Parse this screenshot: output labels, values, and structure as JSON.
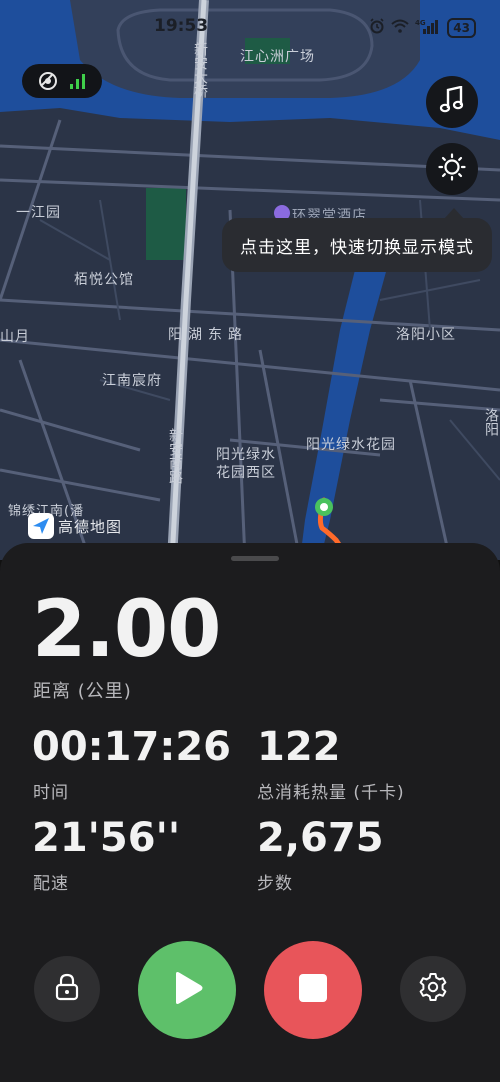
{
  "status_bar": {
    "time": "19:53",
    "battery": "43",
    "network": "4G",
    "icons": [
      "alarm-icon",
      "wifi-icon",
      "signal-icon",
      "battery-icon"
    ]
  },
  "map": {
    "labels": {
      "jiangxinzhou": "江心洲广场",
      "xinan_bridge": "新安大桥",
      "yijiangyuan": "一江园",
      "boyue": "栢悦公馆",
      "hotel": "环翠堂酒店",
      "yanghu_road": "阳湖东路",
      "shanyue": "山月",
      "luoyang": "洛阳小区",
      "jiangnan": "江南宸府",
      "xinan_south": "新安南路",
      "yangguang_west": "阳光绿水花园西区",
      "yangguang": "阳光绿水花园",
      "jinxiu": "锦绣江南(潘",
      "right_edge": "洛阳"
    },
    "buttons": {
      "gps": "gps-signal-icon",
      "music": "music-note-icon",
      "display_mode": "sun-icon"
    },
    "tooltip": "点击这里，快速切换显示模式",
    "logo_text": "高德地图",
    "route_color": "#ff6a2a",
    "water_color": "#1e4e9c"
  },
  "stats": {
    "distance": {
      "value": "2.00",
      "label": "距离 (公里)"
    },
    "time": {
      "value": "00:17:26",
      "label": "时间"
    },
    "calories": {
      "value": "122",
      "label": "总消耗热量 (千卡)"
    },
    "pace": {
      "value": "21'56''",
      "label": "配速"
    },
    "steps": {
      "value": "2,675",
      "label": "步数"
    }
  },
  "controls": {
    "lock": "lock-icon",
    "play": "play-icon",
    "stop": "stop-icon",
    "settings": "gear-icon",
    "play_color": "#5ec06a",
    "stop_color": "#e8555a"
  }
}
